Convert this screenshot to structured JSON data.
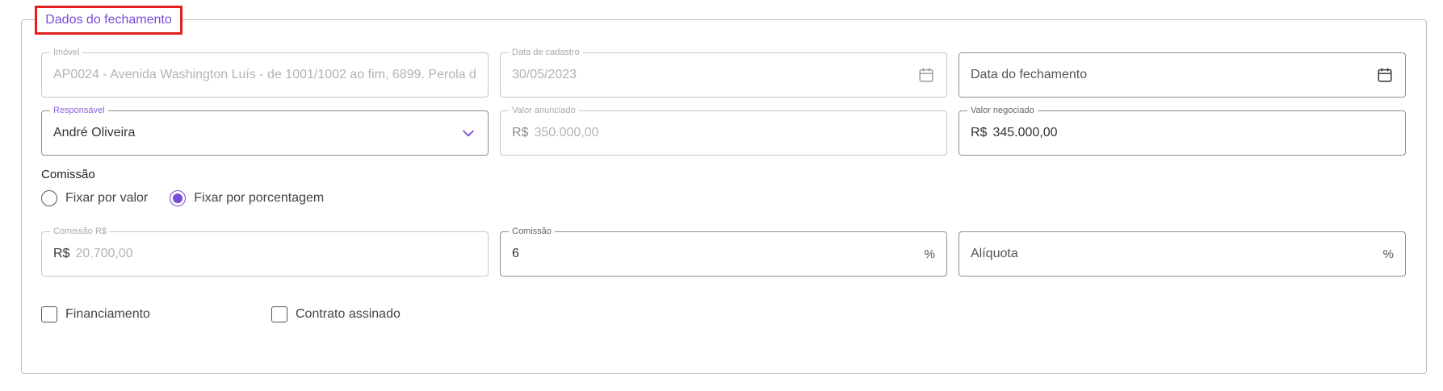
{
  "section": {
    "title": "Dados do fechamento"
  },
  "fields": {
    "imovel": {
      "label": "Imóvel",
      "value": "AP0024 - Avenida Washington Luís - de 1001/1002 ao fim, 6899. Perola d"
    },
    "data_cadastro": {
      "label": "Data de cadastro",
      "value": "30/05/2023",
      "icon": "calendar-icon"
    },
    "data_fechamento": {
      "placeholder": "Data do fechamento",
      "icon": "calendar-icon"
    },
    "responsavel": {
      "label": "Responsável",
      "value": "André Oliveira",
      "icon": "chevron-down-icon"
    },
    "valor_anunciado": {
      "label": "Valor anunciado",
      "prefix": "R$",
      "value": "350.000,00"
    },
    "valor_negociado": {
      "label": "Valor negociado",
      "prefix": "R$",
      "value": "345.000,00"
    },
    "comissao_rs": {
      "label": "Comissão R$",
      "prefix": "R$",
      "value": "20.700,00"
    },
    "comissao_pct": {
      "label": "Comissão",
      "value": "6",
      "suffix": "%"
    },
    "aliquota": {
      "placeholder": "Alíquota",
      "suffix": "%"
    }
  },
  "commission": {
    "label": "Comissão",
    "options": [
      {
        "label": "Fixar por valor",
        "selected": false
      },
      {
        "label": "Fixar por porcentagem",
        "selected": true
      }
    ]
  },
  "checkboxes": [
    {
      "label": "Financiamento",
      "checked": false
    },
    {
      "label": "Contrato assinado",
      "checked": false
    }
  ],
  "colors": {
    "accent": "#7a4bd6",
    "highlight_border": "#e41e1e"
  }
}
